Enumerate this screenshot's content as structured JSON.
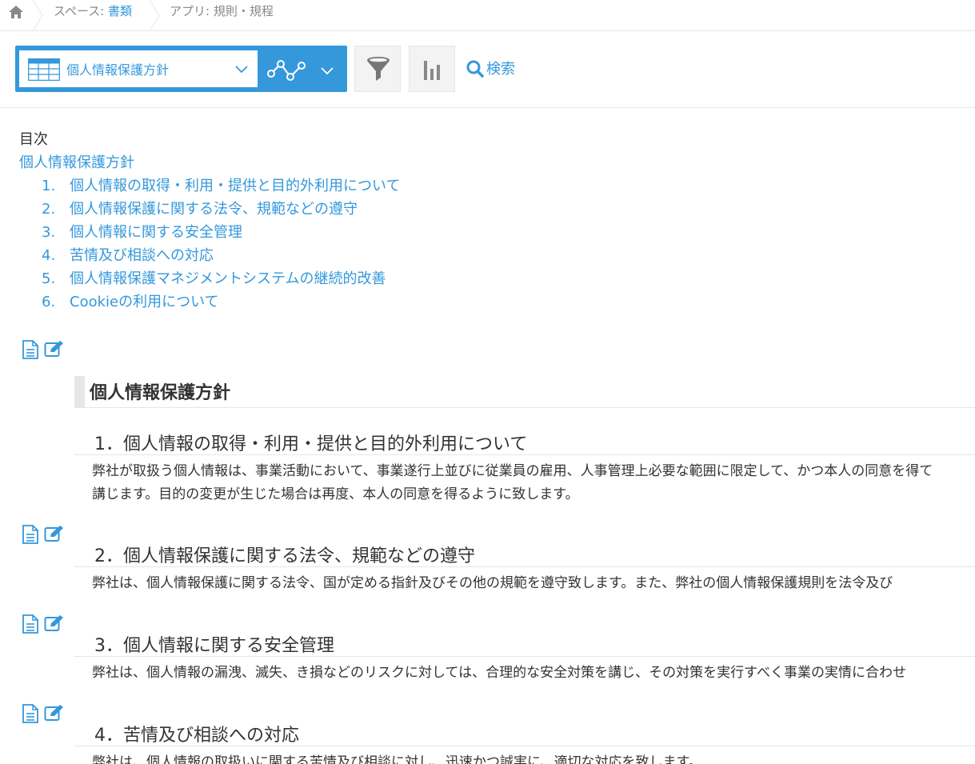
{
  "breadcrumb": {
    "space_prefix": "スペース: ",
    "space_name": "書類",
    "app_label": "アプリ: 規則・規程"
  },
  "toolbar": {
    "view_name": "個人情報保護方針",
    "search_label": "検索"
  },
  "toc": {
    "title": "目次",
    "main": "個人情報保護方針",
    "items": [
      {
        "num": "1.",
        "label": "個人情報の取得・利用・提供と目的外利用について"
      },
      {
        "num": "2.",
        "label": "個人情報保護に関する法令、規範などの遵守"
      },
      {
        "num": "3.",
        "label": "個人情報に関する安全管理"
      },
      {
        "num": "4.",
        "label": "苦情及び相談への対応"
      },
      {
        "num": "5.",
        "label": "個人情報保護マネジメントシステムの継続的改善"
      },
      {
        "num": "6.",
        "label": "Cookieの利用について"
      }
    ]
  },
  "content": {
    "main_title": "個人情報保護方針",
    "sections": [
      {
        "heading": "1．個人情報の取得・利用・提供と目的外利用について",
        "body_lines": [
          "弊社が取扱う個人情報は、事業活動において、事業遂行上並びに従業員の雇用、人事管理上必要な範囲に限定して、かつ本人の同意を得て",
          "講じます。目的の変更が生じた場合は再度、本人の同意を得るように致します。"
        ]
      },
      {
        "heading": "2．個人情報保護に関する法令、規範などの遵守",
        "body_lines": [
          "弊社は、個人情報保護に関する法令、国が定める指針及びその他の規範を遵守致します。また、弊社の個人情報保護規則を法令及び"
        ]
      },
      {
        "heading": "3．個人情報に関する安全管理",
        "body_lines": [
          "弊社は、個人情報の漏洩、滅失、き損などのリスクに対しては、合理的な安全対策を講じ、その対策を実行すべく事業の実情に合わせ"
        ]
      },
      {
        "heading": "4．苦情及び相談への対応",
        "body_lines": [
          "弊社は、個人情報の取扱いに関する苦情及び相談に対し、迅速かつ誠実に、適切な対応を致します。"
        ]
      }
    ]
  },
  "colors": {
    "accent": "#3498db",
    "text": "#333333",
    "border": "#e3e7e8",
    "button_bg": "#f3f3f3",
    "muted": "#888888"
  }
}
